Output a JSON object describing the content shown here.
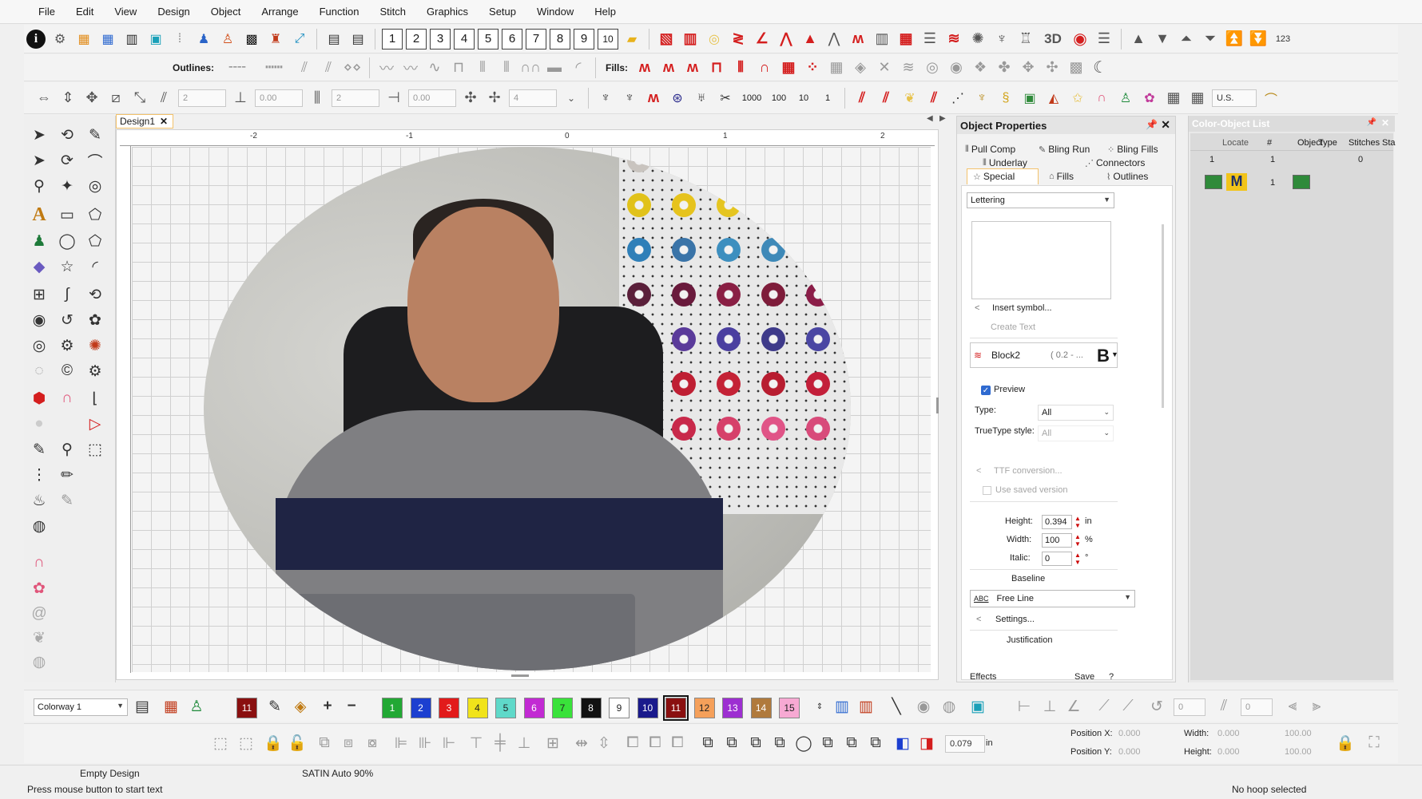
{
  "menu": [
    "File",
    "Edit",
    "View",
    "Design",
    "Object",
    "Arrange",
    "Function",
    "Stitch",
    "Graphics",
    "Setup",
    "Window",
    "Help"
  ],
  "toolbar1": {
    "number_buttons": [
      "1",
      "2",
      "3",
      "4",
      "5",
      "6",
      "7",
      "8",
      "9",
      "10"
    ],
    "label_3d": "3D",
    "label_123": "123"
  },
  "toolbar2": {
    "outlines_label": "Outlines:",
    "fills_label": "Fills:"
  },
  "toolbar3": {
    "fields": [
      "2",
      "0.00",
      "2",
      "0.00",
      "4"
    ],
    "counts": [
      "1000",
      "100",
      "10",
      "1"
    ],
    "units": "U.S."
  },
  "canvas": {
    "design_tab": "Design1",
    "ruler_ticks": [
      "-2",
      "-1",
      "0",
      "1",
      "2"
    ]
  },
  "object_properties": {
    "title": "Object Properties",
    "tabs_row1": [
      "Pull Comp",
      "Bling Run",
      "Bling Fills"
    ],
    "tabs_row2": [
      "Underlay",
      "Connectors"
    ],
    "tabs_row3": [
      "Special",
      "Fills",
      "Outlines"
    ],
    "object_type": "Lettering",
    "insert_symbol": "Insert symbol...",
    "create_text": "Create Text",
    "font_name": "Block2",
    "font_size": "( 0.2 - ...",
    "bold_glyph": "B",
    "preview_label": "Preview",
    "preview_checked": true,
    "type_label": "Type:",
    "type_value": "All",
    "truetype_label": "TrueType style:",
    "truetype_value": "All",
    "ttf_conversion": "TTF conversion...",
    "use_saved_version": "Use saved version",
    "height_label": "Height:",
    "height_value": "0.394",
    "height_unit": "in",
    "width_label": "Width:",
    "width_value": "100",
    "width_unit": "%",
    "italic_label": "Italic:",
    "italic_value": "0",
    "italic_unit": "°",
    "baseline_label": "Baseline",
    "baseline_value": "Free Line",
    "baseline_icon_text": "ABC",
    "settings": "Settings...",
    "justification_label": "Justification",
    "effects_button": "Effects",
    "save_button": "Save",
    "help_button": "?"
  },
  "color_object_list": {
    "title": "Color-Object List",
    "columns": [
      "Locate",
      "#",
      "Object",
      "Type",
      "Stitches",
      "Sta"
    ],
    "row1": {
      "locate": "1",
      "num": "1",
      "stitches": "0"
    },
    "row2": {
      "letter": "M",
      "num": "1"
    }
  },
  "colorway": {
    "label": "Colorway 1",
    "selected_thread": "11",
    "swatches": [
      {
        "label": "1",
        "color": "#22a834"
      },
      {
        "label": "2",
        "color": "#1c3fd0"
      },
      {
        "label": "3",
        "color": "#e21b1b"
      },
      {
        "label": "4",
        "color": "#f1e31a"
      },
      {
        "label": "5",
        "color": "#5fd9c9"
      },
      {
        "label": "6",
        "color": "#c22ad3"
      },
      {
        "label": "7",
        "color": "#39e23a"
      },
      {
        "label": "8",
        "color": "#111111"
      },
      {
        "label": "9",
        "color": "#ffffff"
      },
      {
        "label": "10",
        "color": "#1a1a8c"
      },
      {
        "label": "11",
        "color": "#8a1010"
      },
      {
        "label": "12",
        "color": "#f5a05a"
      },
      {
        "label": "13",
        "color": "#9d2fd1"
      },
      {
        "label": "14",
        "color": "#b07a3c"
      },
      {
        "label": "15",
        "color": "#f7a9d3"
      }
    ]
  },
  "bottom_tools": {
    "stitch_length": "0.079",
    "stitch_unit": "in",
    "posx_label": "Position X:",
    "posx_value": "0.000",
    "posy_label": "Position Y:",
    "posy_value": "0.000",
    "width_label": "Width:",
    "width_value": "0.000",
    "width_pct": "100.00",
    "height_label": "Height:",
    "height_value": "0.000",
    "height_pct": "100.00",
    "zero1": "0",
    "zero2": "0"
  },
  "status": {
    "design_state": "Empty Design",
    "stitch_type": "SATIN Auto 90%",
    "hint": "Press mouse button to start text",
    "hoop": "No hoop selected"
  }
}
